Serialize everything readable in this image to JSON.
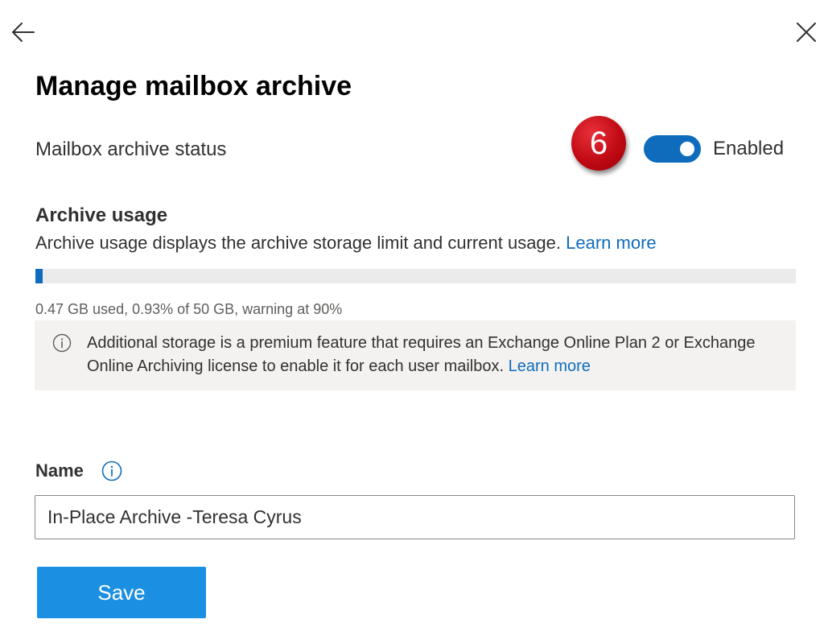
{
  "icons": {
    "back": "arrow-left",
    "close": "close-x",
    "info": "info-circle"
  },
  "colors": {
    "accent": "#0f6cbd",
    "save_button": "#1b8fe2",
    "step_badge": "#c00a14"
  },
  "panel": {
    "title": "Manage mailbox archive"
  },
  "archive_status": {
    "label": "Mailbox archive status",
    "step_number": "6",
    "toggle_state": "Enabled",
    "enabled": true
  },
  "archive_usage": {
    "heading": "Archive usage",
    "description": "Archive usage displays the archive storage limit and current usage.",
    "learn_more": "Learn more",
    "percent_used": 0.93,
    "usage_text": "0.47 GB used, 0.93% of 50 GB, warning at 90%"
  },
  "info_notice": {
    "text": "Additional storage is a premium feature that requires an Exchange Online Plan 2 or Exchange Online Archiving license to enable it for each user mailbox.",
    "learn_more": "Learn more"
  },
  "name_field": {
    "label": "Name",
    "value": "In-Place Archive -Teresa Cyrus"
  },
  "actions": {
    "save": "Save"
  }
}
